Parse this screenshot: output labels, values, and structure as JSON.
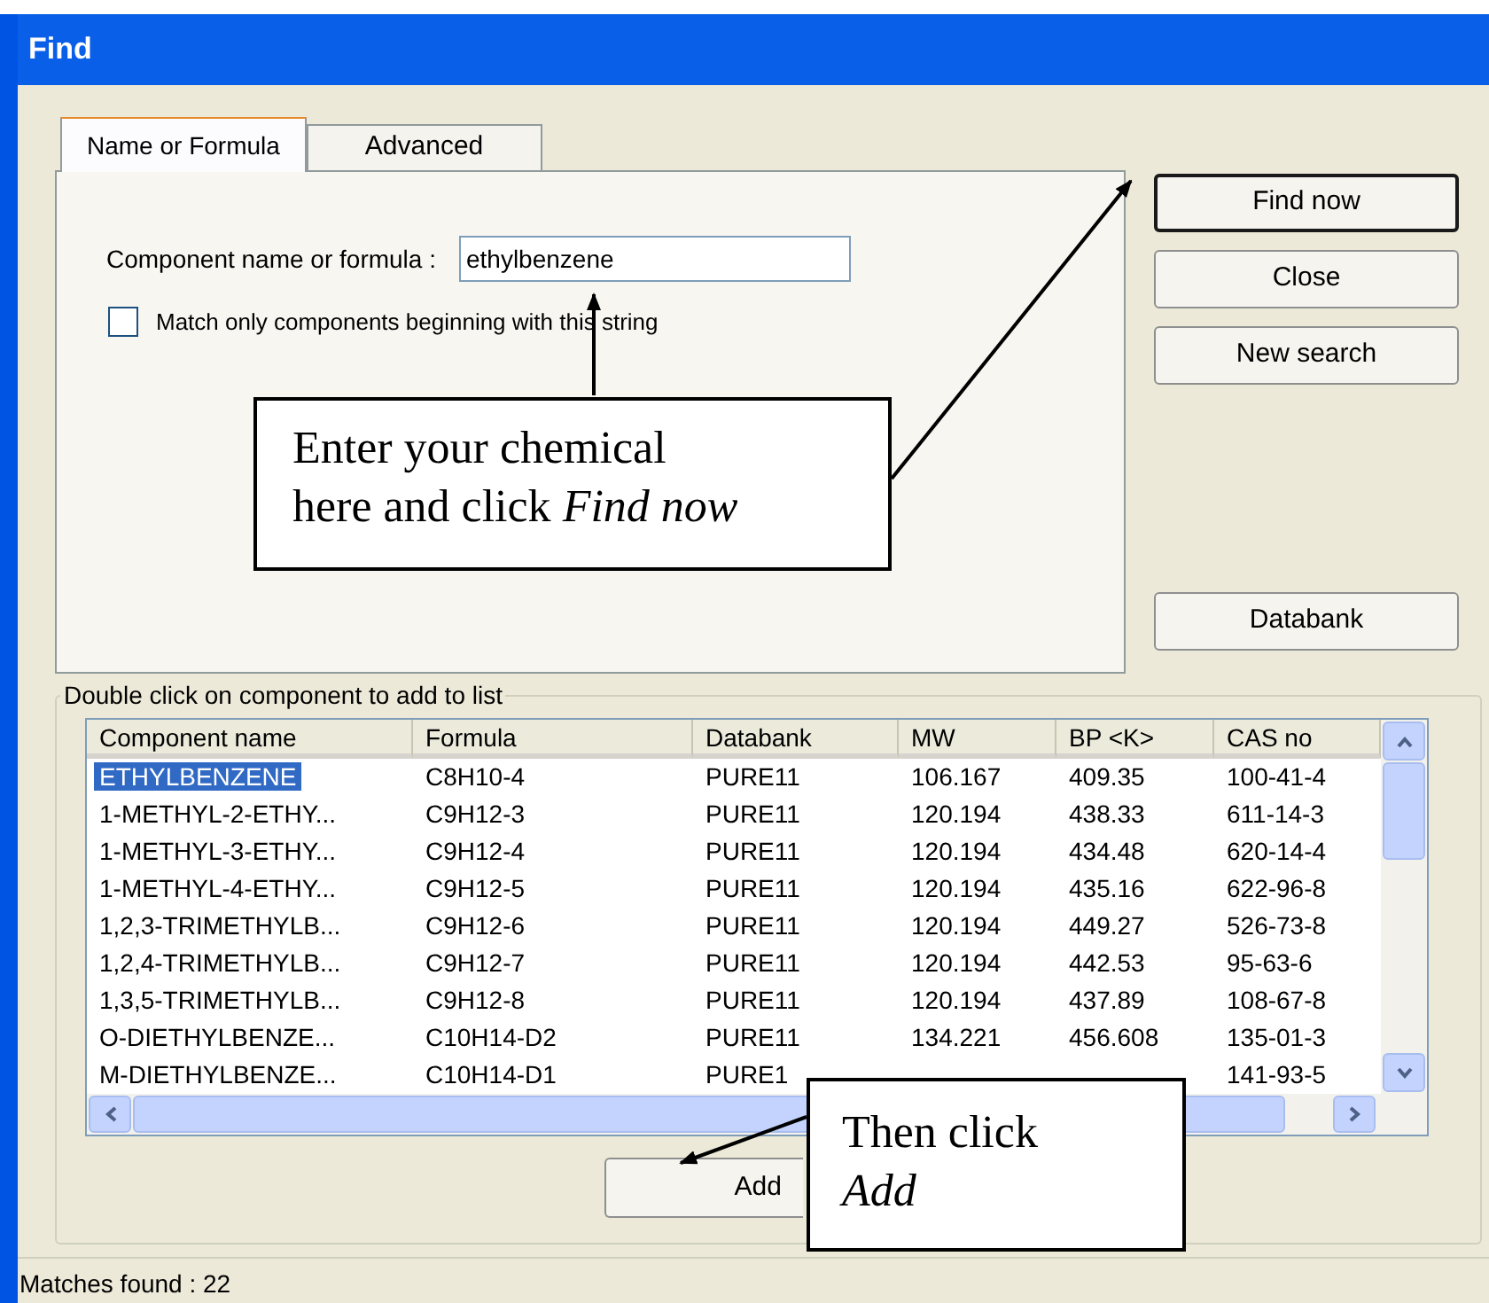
{
  "window": {
    "title": "Find"
  },
  "tabs": [
    {
      "label": "Name or Formula",
      "selected": true
    },
    {
      "label": "Advanced",
      "selected": false
    }
  ],
  "search": {
    "label": "Component name or formula :",
    "value": "ethylbenzene"
  },
  "match_option": {
    "label": "Match only components beginning with this string",
    "checked": false
  },
  "buttons": [
    {
      "label": "Find now",
      "default": true
    },
    {
      "label": "Close",
      "default": false
    },
    {
      "label": "New search",
      "default": false
    }
  ],
  "databank_button": "Databank",
  "results": {
    "title": "Double click on component to add to list",
    "columns": [
      "Component name",
      "Formula",
      "Databank",
      "MW",
      "BP <K>",
      "CAS no"
    ],
    "rows": [
      {
        "selected": true,
        "component_name": "ETHYLBENZENE",
        "formula": "C8H10-4",
        "databank": "PURE11",
        "mw": "106.167",
        "bp": "409.35",
        "cas_no": "100-41-4"
      },
      {
        "selected": false,
        "component_name": "1-METHYL-2-ETHY...",
        "formula": "C9H12-3",
        "databank": "PURE11",
        "mw": "120.194",
        "bp": "438.33",
        "cas_no": "611-14-3"
      },
      {
        "selected": false,
        "component_name": "1-METHYL-3-ETHY...",
        "formula": "C9H12-4",
        "databank": "PURE11",
        "mw": "120.194",
        "bp": "434.48",
        "cas_no": "620-14-4"
      },
      {
        "selected": false,
        "component_name": "1-METHYL-4-ETHY...",
        "formula": "C9H12-5",
        "databank": "PURE11",
        "mw": "120.194",
        "bp": "435.16",
        "cas_no": "622-96-8"
      },
      {
        "selected": false,
        "component_name": "1,2,3-TRIMETHYLB...",
        "formula": "C9H12-6",
        "databank": "PURE11",
        "mw": "120.194",
        "bp": "449.27",
        "cas_no": "526-73-8"
      },
      {
        "selected": false,
        "component_name": "1,2,4-TRIMETHYLB...",
        "formula": "C9H12-7",
        "databank": "PURE11",
        "mw": "120.194",
        "bp": "442.53",
        "cas_no": "95-63-6"
      },
      {
        "selected": false,
        "component_name": "1,3,5-TRIMETHYLB...",
        "formula": "C9H12-8",
        "databank": "PURE11",
        "mw": "120.194",
        "bp": "437.89",
        "cas_no": "108-67-8"
      },
      {
        "selected": false,
        "component_name": "O-DIETHYLBENZE...",
        "formula": "C10H14-D2",
        "databank": "PURE11",
        "mw": "134.221",
        "bp": "456.608",
        "cas_no": "135-01-3"
      },
      {
        "selected": false,
        "component_name": "M-DIETHYLBENZE...",
        "formula": "C10H14-D1",
        "databank": "PURE1",
        "cas_no": "141-93-5"
      }
    ]
  },
  "add_button": "Add",
  "status_bar": "Matches found : 22",
  "callouts": [
    {
      "text": "Enter your chemical\nhere and click *Find now*"
    },
    {
      "text": "Then click\n*Add*"
    }
  ]
}
